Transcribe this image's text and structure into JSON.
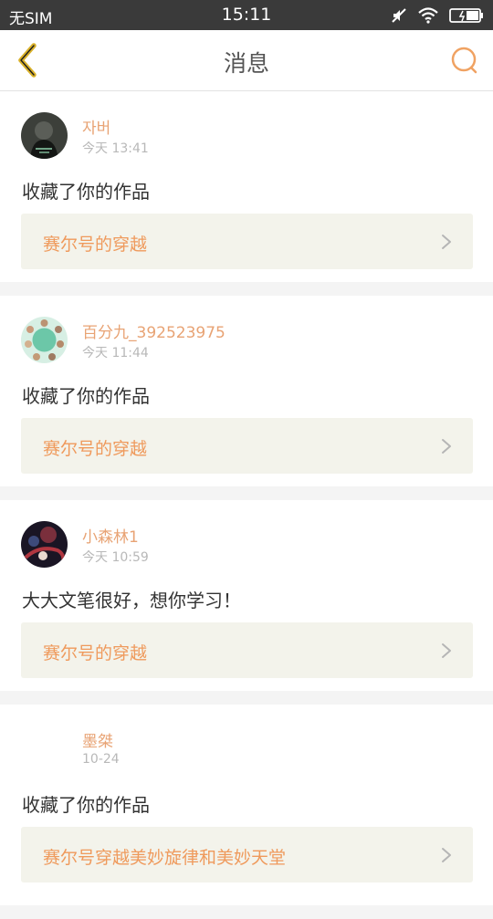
{
  "status_bar": {
    "carrier": "无SIM",
    "time": "15:11",
    "icons": [
      "mute-icon",
      "wifi-icon",
      "battery-icon"
    ]
  },
  "header": {
    "title": "消息",
    "back_icon": "back-chevron-icon",
    "search_icon": "search-icon"
  },
  "colors": {
    "accent": "#ef9a5c",
    "username": "#e8a374",
    "back_icon": "#d9b12a",
    "card_link_bg": "#f3f3eb"
  },
  "messages": [
    {
      "username": "자버",
      "time": "今天 13:41",
      "text": "收藏了你的作品",
      "work": "赛尔号的穿越"
    },
    {
      "username": "百分九_392523975",
      "time": "今天 11:44",
      "text": "收藏了你的作品",
      "work": "赛尔号的穿越"
    },
    {
      "username": "小森林1",
      "time": "今天 10:59",
      "text": "大大文笔很好，想你学习！",
      "work": "赛尔号的穿越"
    },
    {
      "username": "墨桀",
      "time": "10-24",
      "text": "收藏了你的作品",
      "work": "赛尔号穿越美妙旋律和美妙天堂"
    }
  ]
}
